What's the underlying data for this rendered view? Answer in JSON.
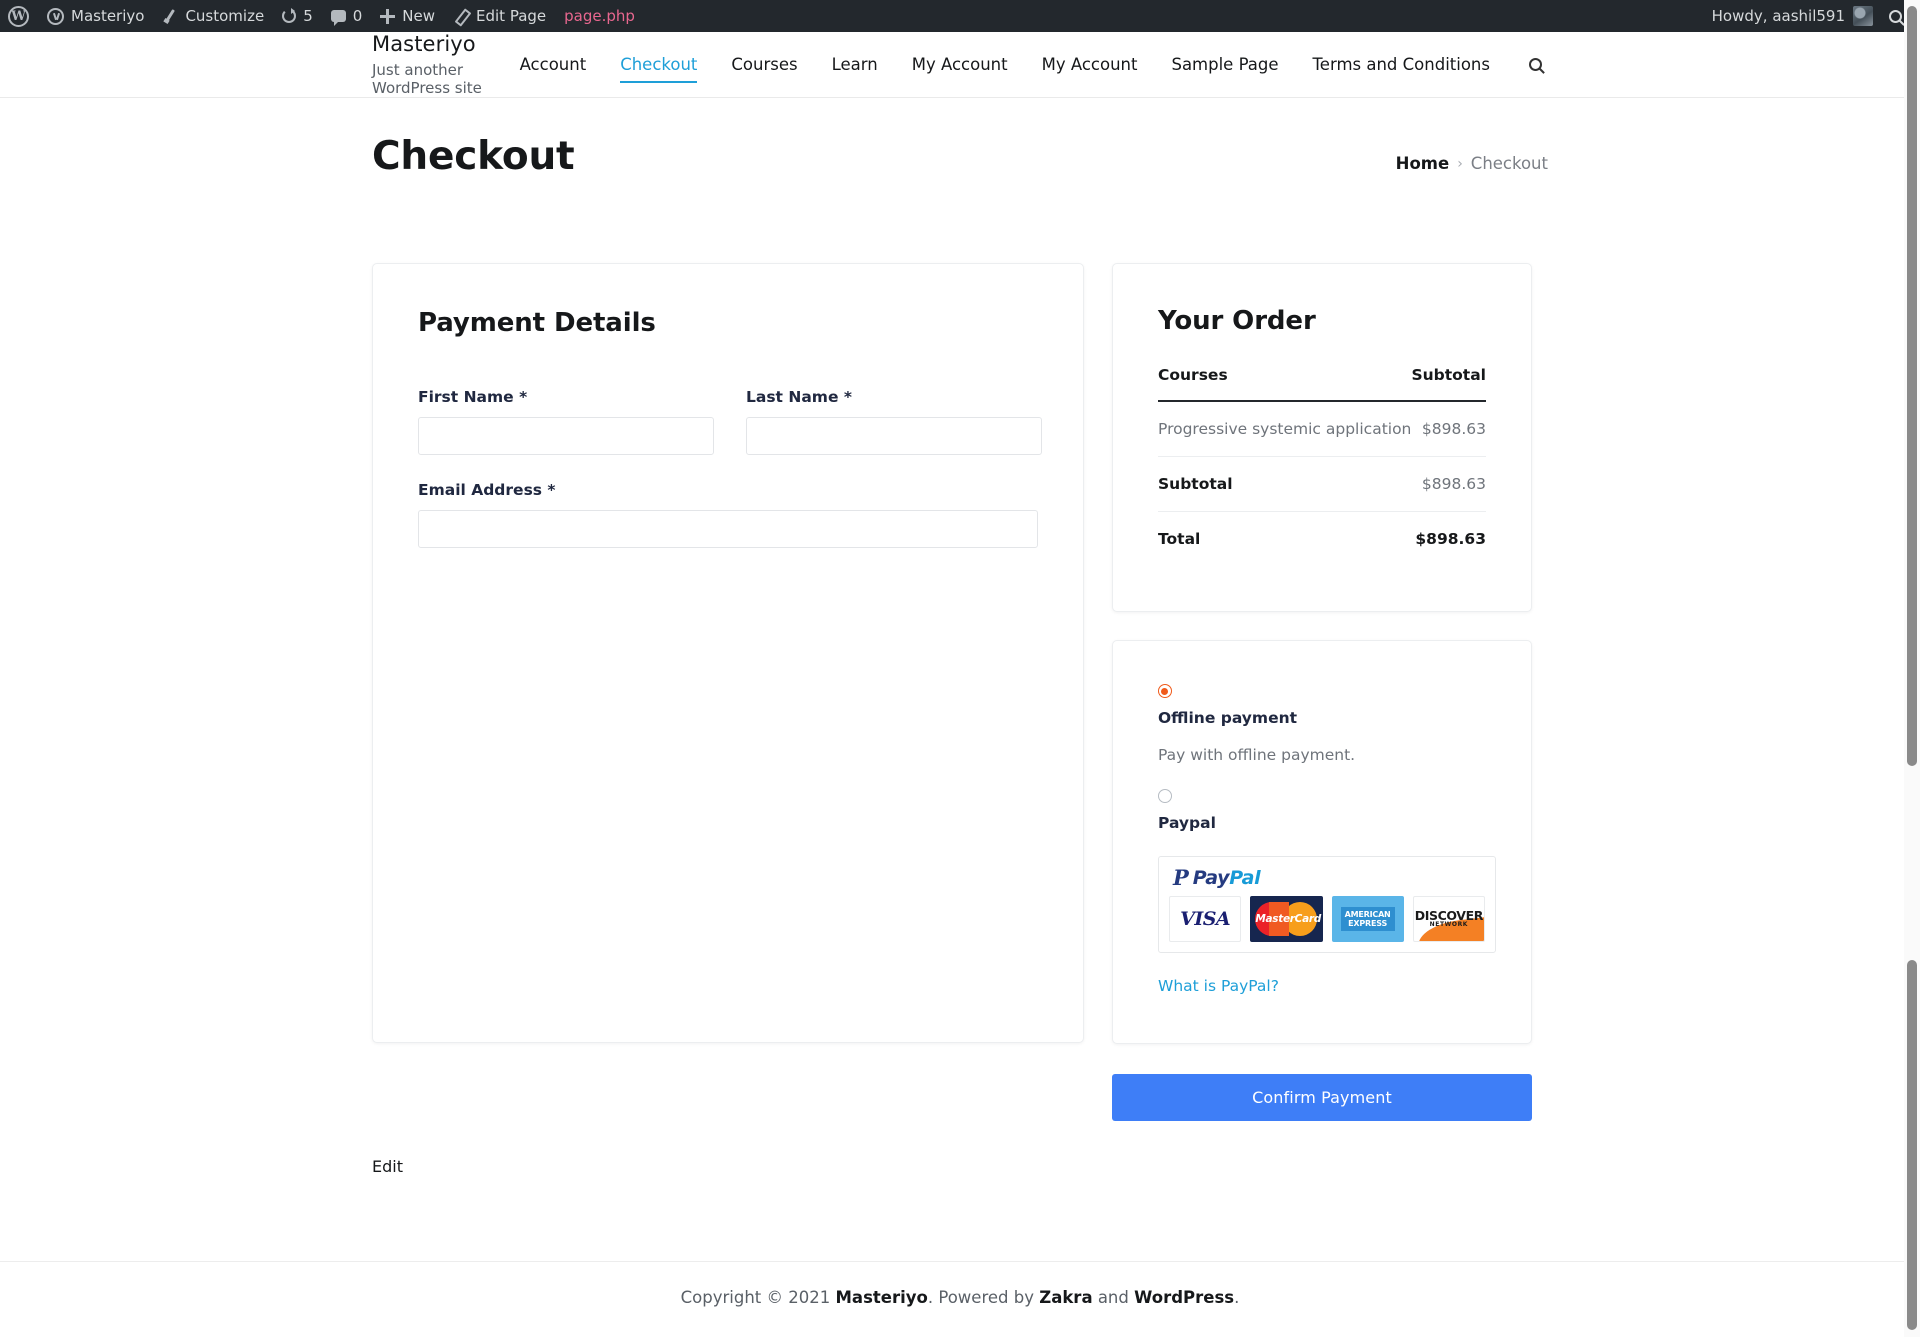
{
  "adminbar": {
    "wp_logo": "wordpress-logo",
    "items": [
      {
        "label": "Masteriyo",
        "icon": "site-icon"
      },
      {
        "label": "Customize",
        "icon": "brush-icon"
      },
      {
        "label": "5",
        "icon": "refresh-icon"
      },
      {
        "label": "0",
        "icon": "comment-bubble-icon"
      },
      {
        "label": "New",
        "icon": "plus-icon"
      },
      {
        "label": "Edit Page",
        "icon": "pencil-icon"
      }
    ],
    "template_file": "page.php",
    "howdy": "Howdy, aashil591",
    "search_icon": "search-icon"
  },
  "header": {
    "site_title": "Masteriyo",
    "tagline": "Just another WordPress site",
    "nav": [
      {
        "label": "Account",
        "active": false
      },
      {
        "label": "Checkout",
        "active": true
      },
      {
        "label": "Courses",
        "active": false
      },
      {
        "label": "Learn",
        "active": false
      },
      {
        "label": "My Account",
        "active": false
      },
      {
        "label": "My Account",
        "active": false
      },
      {
        "label": "Sample Page",
        "active": false
      },
      {
        "label": "Terms and Conditions",
        "active": false
      }
    ],
    "search_icon": "search-icon",
    "accent_color": "#1e9fd8"
  },
  "pagehead": {
    "title": "Checkout",
    "breadcrumb_home": "Home",
    "breadcrumb_sep": "›",
    "breadcrumb_current": "Checkout"
  },
  "payment_details": {
    "title": "Payment Details",
    "fields": {
      "first_name_label": "First Name *",
      "first_name_value": "",
      "first_name_placeholder": "",
      "last_name_label": "Last Name *",
      "last_name_value": "",
      "last_name_placeholder": "",
      "email_label": "Email Address *",
      "email_value": "",
      "email_placeholder": ""
    }
  },
  "order": {
    "title": "Your Order",
    "col_courses": "Courses",
    "col_subtotal": "Subtotal",
    "items": [
      {
        "name": "Progressive systemic application",
        "price": "$898.63"
      }
    ],
    "subtotal_label": "Subtotal",
    "subtotal_value": "$898.63",
    "total_label": "Total",
    "total_value": "$898.63"
  },
  "payment_methods": {
    "offline": {
      "name": "Offline payment",
      "description": "Pay with offline payment.",
      "selected": true,
      "radio_color": "#f05a1a"
    },
    "paypal": {
      "name": "Paypal",
      "selected": false,
      "brand_text_1": "Pay",
      "brand_text_2": "Pal",
      "cards": [
        {
          "name": "visa-logo",
          "label": "VISA"
        },
        {
          "name": "mastercard-logo",
          "label": "MasterCard"
        },
        {
          "name": "amex-logo",
          "label": "AMERICAN EXPRESS"
        },
        {
          "name": "discover-logo",
          "label": "DISCOVER",
          "sub": "NETWORK"
        }
      ],
      "what_is_paypal": "What is PayPal?"
    }
  },
  "confirm_button": {
    "label": "Confirm Payment",
    "color": "#3e7ef7"
  },
  "edit_link": "Edit",
  "footer": {
    "prefix": "Copyright © 2021 ",
    "site": "Masteriyo",
    "middle": ". Powered by ",
    "theme": "Zakra",
    "and": " and ",
    "platform": "WordPress",
    "suffix": "."
  }
}
